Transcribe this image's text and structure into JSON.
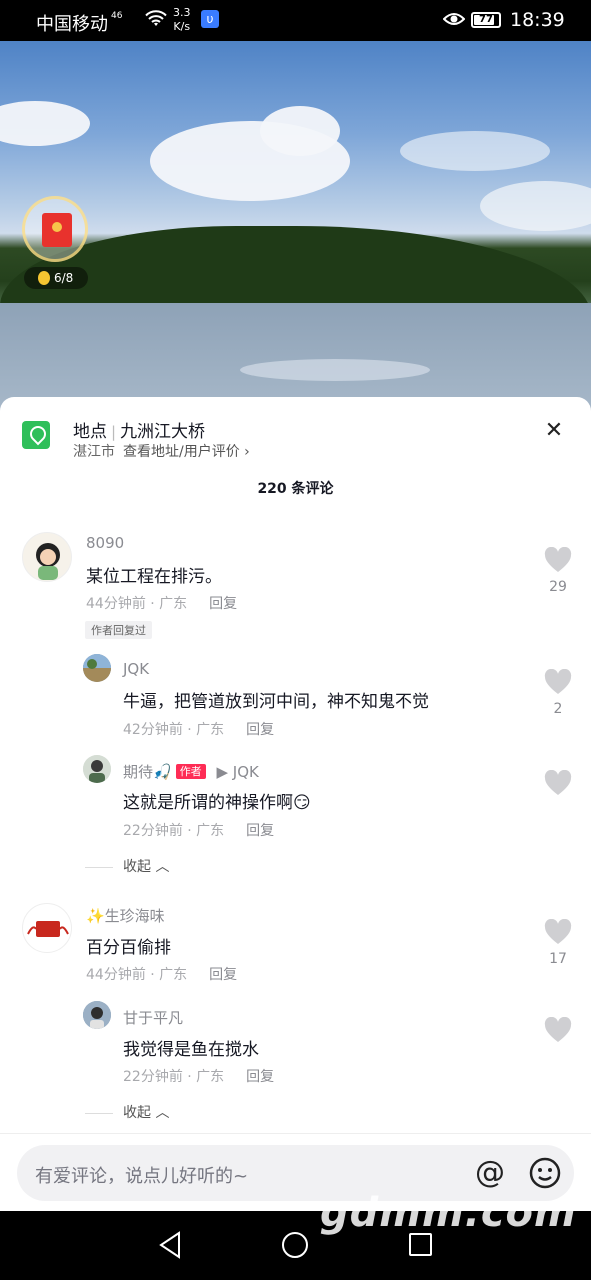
{
  "status_bar": {
    "carrier": "中国移动",
    "network": "46",
    "speed_top": "3.3",
    "speed_bottom": "K/s",
    "battery": "77",
    "time": "18:39"
  },
  "video": {
    "coin_progress": "6/8"
  },
  "location": {
    "label": "地点",
    "name": "九洲江大桥",
    "city": "湛江市",
    "link": "查看地址/用户评价 ›"
  },
  "comments_header": {
    "count_label": "220 条评论"
  },
  "comments": [
    {
      "name": "8090",
      "text": "某位工程在排污。",
      "meta": "44分钟前 · 广东",
      "reply": "回复",
      "likes": "29",
      "author_replied": "作者回复过",
      "replies": [
        {
          "name": "JQK",
          "text": "牛逼，把管道放到河中间，神不知鬼不觉",
          "meta": "42分钟前 · 广东",
          "reply": "回复",
          "likes": "2"
        },
        {
          "name": "期待🎣",
          "author_tag": "作者",
          "reply_to": "▶ JQK",
          "text": "这就是所谓的神操作啊😏",
          "meta": "22分钟前 · 广东",
          "reply": "回复"
        }
      ],
      "collapse": "收起 ︿"
    },
    {
      "name": "✨生珍海味",
      "text": "百分百偷排",
      "meta": "44分钟前 · 广东",
      "reply": "回复",
      "likes": "17",
      "replies": [
        {
          "name": "甘于平凡",
          "text": "我觉得是鱼在搅水",
          "meta": "22分钟前 · 广东",
          "reply": "回复"
        }
      ],
      "collapse": "收起 ︿"
    }
  ],
  "input": {
    "placeholder": "有爱评论，说点儿好听的~"
  },
  "watermark": "gdmm.com"
}
